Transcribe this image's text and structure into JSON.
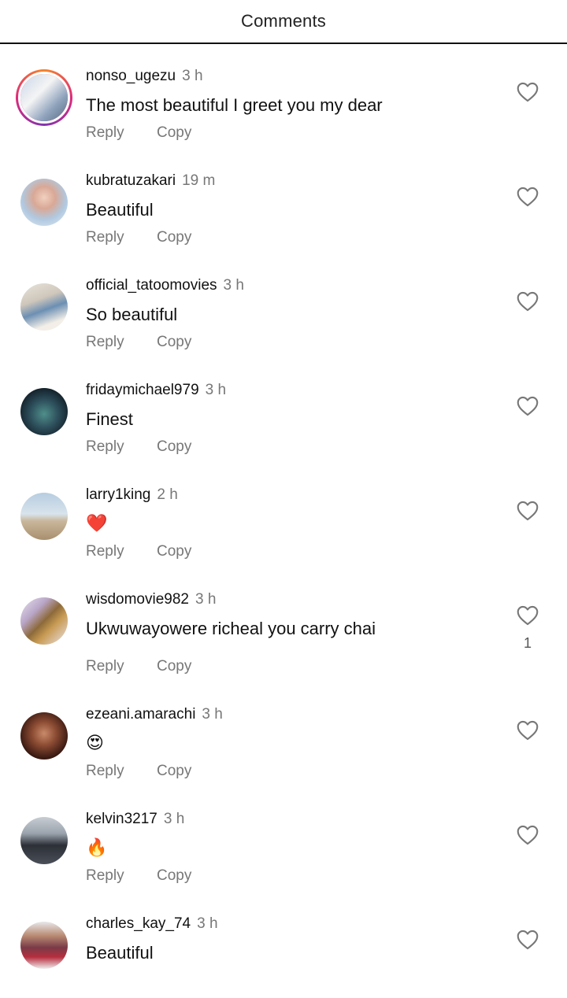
{
  "header": {
    "title": "Comments"
  },
  "actions": {
    "reply": "Reply",
    "copy": "Copy"
  },
  "comments": [
    {
      "username": "nonso_ugezu",
      "time": "3 h",
      "text": "The most beautiful I greet you my dear",
      "likes": ""
    },
    {
      "username": "kubratuzakari",
      "time": "19 m",
      "text": "Beautiful",
      "likes": ""
    },
    {
      "username": "official_tatoomovies",
      "time": "3 h",
      "text": "So beautiful",
      "likes": ""
    },
    {
      "username": "fridaymichael979",
      "time": "3 h",
      "text": "Finest",
      "likes": ""
    },
    {
      "username": "larry1king",
      "time": "2 h",
      "text": "❤️",
      "likes": ""
    },
    {
      "username": "wisdomovie982",
      "time": "3 h",
      "text": "Ukwuwayowere richeal you carry chai",
      "likes": "1"
    },
    {
      "username": "ezeani.amarachi",
      "time": "3 h",
      "text": "😍",
      "likes": ""
    },
    {
      "username": "kelvin3217",
      "time": "3 h",
      "text": "🔥",
      "likes": ""
    },
    {
      "username": "charles_kay_74",
      "time": "3 h",
      "text": "Beautiful",
      "likes": ""
    }
  ]
}
